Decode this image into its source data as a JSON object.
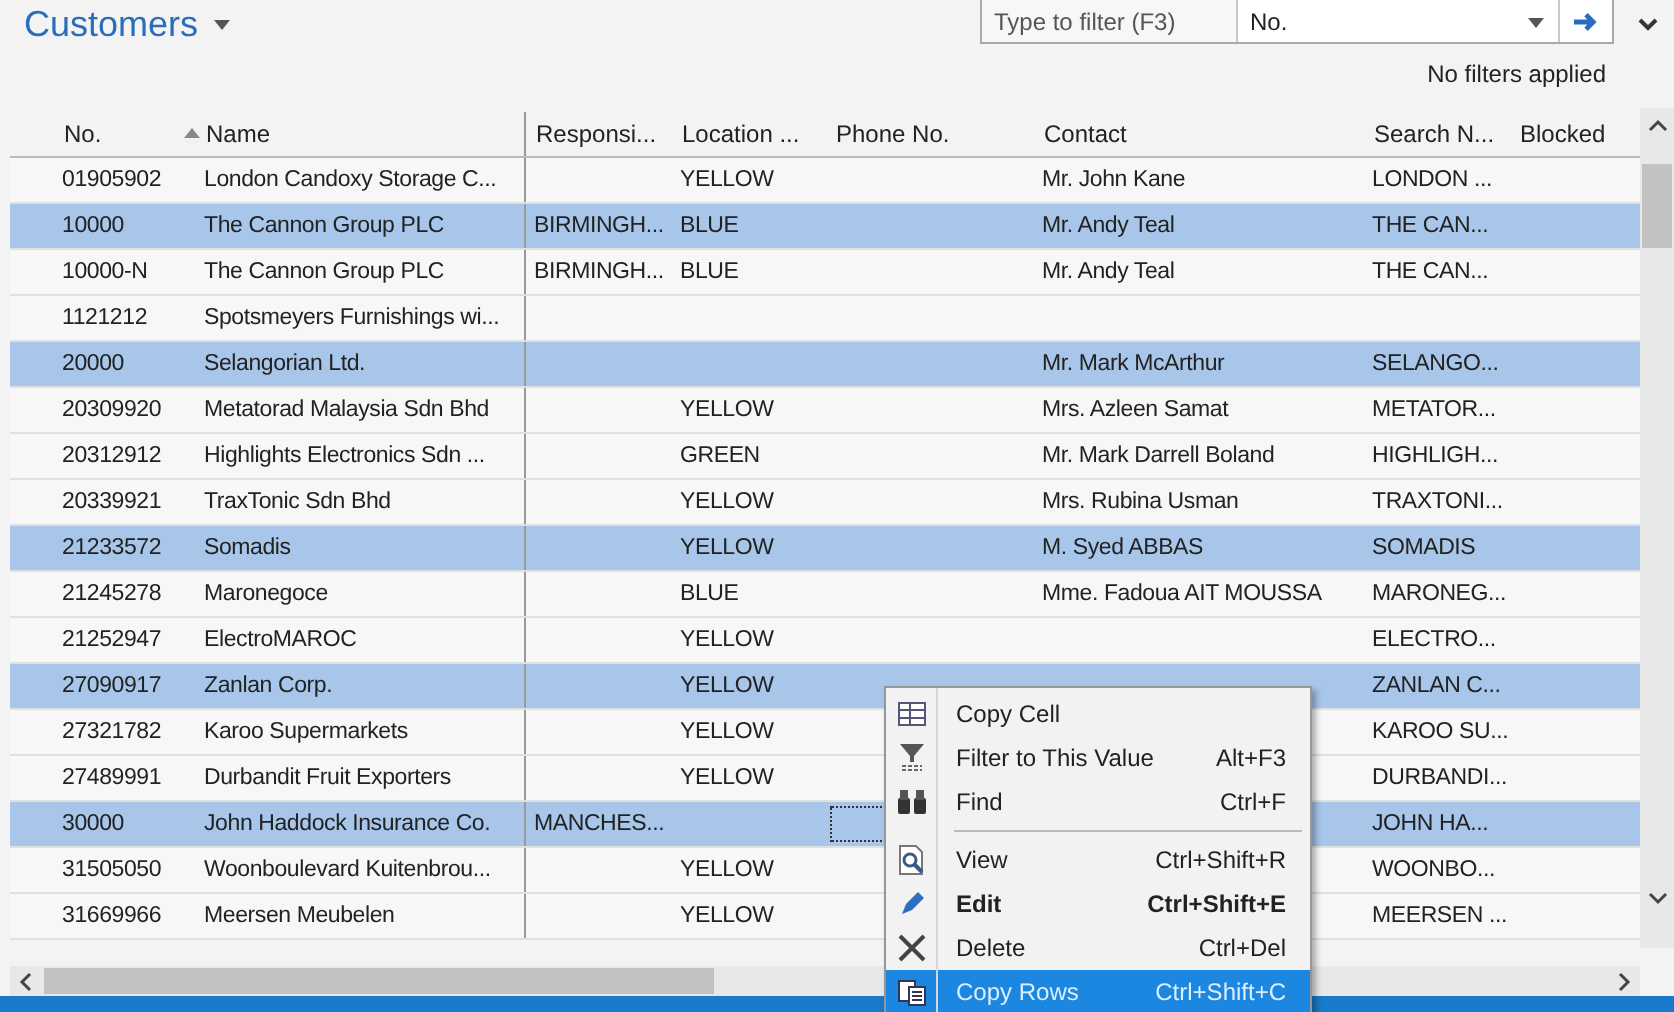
{
  "page": {
    "title": "Customers"
  },
  "filter": {
    "placeholder": "Type to filter (F3)",
    "field": "No.",
    "status": "No filters applied"
  },
  "table": {
    "columns": [
      {
        "label": "No.",
        "sorted": true
      },
      {
        "label": "Name",
        "sorted": false
      },
      {
        "label": "Responsi...",
        "sorted": false
      },
      {
        "label": "Location ...",
        "sorted": false
      },
      {
        "label": "Phone No.",
        "sorted": false
      },
      {
        "label": "Contact",
        "sorted": false
      },
      {
        "label": "Search N...",
        "sorted": false
      },
      {
        "label": "Blocked",
        "sorted": false
      }
    ],
    "rows": [
      {
        "selected": false,
        "focused": false,
        "cells": [
          "01905902",
          "London Candoxy Storage C...",
          "",
          "YELLOW",
          "",
          "Mr. John Kane",
          "LONDON ...",
          ""
        ]
      },
      {
        "selected": true,
        "focused": false,
        "cells": [
          "10000",
          "The Cannon Group PLC",
          "BIRMINGH...",
          "BLUE",
          "",
          "Mr. Andy Teal",
          "THE CAN...",
          ""
        ]
      },
      {
        "selected": false,
        "focused": false,
        "cells": [
          "10000-N",
          "The Cannon Group PLC",
          "BIRMINGH...",
          "BLUE",
          "",
          "Mr. Andy Teal",
          "THE CAN...",
          ""
        ]
      },
      {
        "selected": false,
        "focused": false,
        "cells": [
          "1121212",
          "Spotsmeyers Furnishings wi...",
          "",
          "",
          "",
          "",
          "",
          ""
        ]
      },
      {
        "selected": true,
        "focused": false,
        "cells": [
          "20000",
          "Selangorian Ltd.",
          "",
          "",
          "",
          "Mr. Mark McArthur",
          "SELANGO...",
          ""
        ]
      },
      {
        "selected": false,
        "focused": false,
        "cells": [
          "20309920",
          "Metatorad Malaysia Sdn Bhd",
          "",
          "YELLOW",
          "",
          "Mrs. Azleen Samat",
          "METATOR...",
          ""
        ]
      },
      {
        "selected": false,
        "focused": false,
        "cells": [
          "20312912",
          "Highlights Electronics Sdn ...",
          "",
          "GREEN",
          "",
          "Mr. Mark Darrell Boland",
          "HIGHLIGH...",
          ""
        ]
      },
      {
        "selected": false,
        "focused": false,
        "cells": [
          "20339921",
          "TraxTonic Sdn Bhd",
          "",
          "YELLOW",
          "",
          "Mrs. Rubina Usman",
          "TRAXTONI...",
          ""
        ]
      },
      {
        "selected": true,
        "focused": false,
        "cells": [
          "21233572",
          "Somadis",
          "",
          "YELLOW",
          "",
          "M. Syed ABBAS",
          "SOMADIS",
          ""
        ]
      },
      {
        "selected": false,
        "focused": false,
        "cells": [
          "21245278",
          "Maronegoce",
          "",
          "BLUE",
          "",
          "Mme. Fadoua AIT MOUSSA",
          "MARONEG...",
          ""
        ]
      },
      {
        "selected": false,
        "focused": false,
        "cells": [
          "21252947",
          "ElectroMAROC",
          "",
          "YELLOW",
          "",
          "",
          "ELECTRO...",
          ""
        ]
      },
      {
        "selected": true,
        "focused": false,
        "cells": [
          "27090917",
          "Zanlan Corp.",
          "",
          "YELLOW",
          "",
          "",
          "ZANLAN C...",
          ""
        ]
      },
      {
        "selected": false,
        "focused": false,
        "cells": [
          "27321782",
          "Karoo Supermarkets",
          "",
          "YELLOW",
          "",
          "",
          "KAROO SU...",
          ""
        ]
      },
      {
        "selected": false,
        "focused": false,
        "cells": [
          "27489991",
          "Durbandit Fruit Exporters",
          "",
          "YELLOW",
          "",
          "",
          "DURBANDI...",
          ""
        ]
      },
      {
        "selected": true,
        "focused": true,
        "cells": [
          "30000",
          "John Haddock Insurance Co.",
          "MANCHES...",
          "",
          "",
          "",
          "JOHN HA...",
          ""
        ]
      },
      {
        "selected": false,
        "focused": false,
        "cells": [
          "31505050",
          "Woonboulevard Kuitenbrou...",
          "",
          "YELLOW",
          "",
          "",
          "WOONBO...",
          ""
        ]
      },
      {
        "selected": false,
        "focused": false,
        "cells": [
          "31669966",
          "Meersen Meubelen",
          "",
          "YELLOW",
          "",
          "",
          "MEERSEN ...",
          ""
        ]
      }
    ]
  },
  "context_menu": {
    "items": [
      {
        "kind": "item",
        "label": "Copy Cell",
        "selected": false,
        "bold": false
      },
      {
        "kind": "item",
        "label": "Filter to This Value",
        "shortcut": "Alt+F3",
        "selected": false,
        "bold": false
      },
      {
        "kind": "item",
        "label": "Find",
        "shortcut": "Ctrl+F",
        "selected": false,
        "bold": false
      },
      {
        "kind": "separator"
      },
      {
        "kind": "item",
        "label": "View",
        "shortcut": "Ctrl+Shift+R",
        "selected": false,
        "bold": false
      },
      {
        "kind": "item",
        "label": "Edit",
        "shortcut": "Ctrl+Shift+E",
        "selected": false,
        "bold": true
      },
      {
        "kind": "item",
        "label": "Delete",
        "shortcut": "Ctrl+Del",
        "selected": false,
        "bold": false
      },
      {
        "kind": "item",
        "label": "Copy Rows",
        "shortcut": "Ctrl+Shift+C",
        "selected": true,
        "bold": false
      }
    ]
  }
}
